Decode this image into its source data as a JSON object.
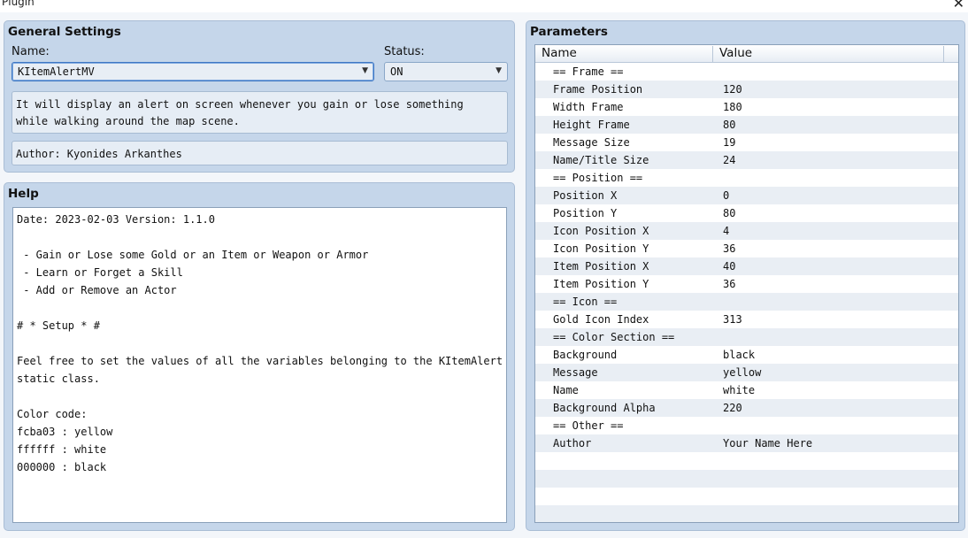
{
  "window": {
    "title": "Plugin",
    "close_glyph": "✕"
  },
  "general": {
    "title": "General Settings",
    "name_label": "Name:",
    "name_value": "KItemAlertMV",
    "status_label": "Status:",
    "status_value": "ON",
    "description_lines": [
      "It will display an alert on screen whenever you gain or lose something",
      "while walking around the map scene."
    ],
    "author": "Author: Kyonides Arkanthes"
  },
  "help": {
    "title": "Help",
    "lines": [
      "Date: 2023-02-03 Version: 1.1.0",
      "",
      " - Gain or Lose some Gold or an Item or Weapon or Armor",
      " - Learn or Forget a Skill",
      " - Add or Remove an Actor",
      "",
      "# * Setup * #",
      "",
      "Feel free to set the values of all the variables belonging to the KItemAlert",
      "static class.",
      "",
      "Color code:",
      "fcba03 : yellow",
      "ffffff : white",
      "000000 : black"
    ]
  },
  "parameters": {
    "title": "Parameters",
    "columns": [
      "Name",
      "Value"
    ],
    "rows": [
      {
        "name": "== Frame ==",
        "value": ""
      },
      {
        "name": "Frame Position",
        "value": "120"
      },
      {
        "name": "Width Frame",
        "value": "180"
      },
      {
        "name": "Height Frame",
        "value": "80"
      },
      {
        "name": "Message Size",
        "value": "19"
      },
      {
        "name": "Name/Title Size",
        "value": "24"
      },
      {
        "name": "== Position ==",
        "value": ""
      },
      {
        "name": "Position X",
        "value": "0"
      },
      {
        "name": "Position Y",
        "value": "80"
      },
      {
        "name": "Icon Position X",
        "value": "4"
      },
      {
        "name": "Icon Position Y",
        "value": "36"
      },
      {
        "name": "Item Position X",
        "value": "40"
      },
      {
        "name": "Item Position Y",
        "value": "36"
      },
      {
        "name": "== Icon ==",
        "value": ""
      },
      {
        "name": "Gold Icon Index",
        "value": "313"
      },
      {
        "name": "== Color Section ==",
        "value": ""
      },
      {
        "name": "Background",
        "value": "black"
      },
      {
        "name": "Message",
        "value": "yellow"
      },
      {
        "name": "Name",
        "value": "white"
      },
      {
        "name": "Background Alpha",
        "value": "220"
      },
      {
        "name": "== Other ==",
        "value": ""
      },
      {
        "name": "Author",
        "value": "Your Name Here"
      },
      {
        "name": "",
        "value": ""
      },
      {
        "name": "",
        "value": ""
      },
      {
        "name": "",
        "value": ""
      },
      {
        "name": "",
        "value": ""
      }
    ]
  },
  "colors": {
    "panel_bg": "#c5d6ea",
    "field_bg": "#e6edf5",
    "row_alt": "#e9eef4",
    "focus_border": "#3f78c4"
  }
}
